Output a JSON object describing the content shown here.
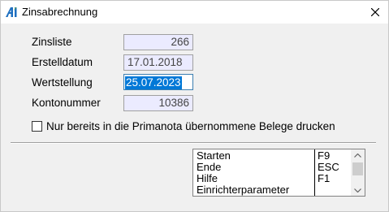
{
  "window": {
    "title": "Zinsabrechnung"
  },
  "form": {
    "zinsliste": {
      "label": "Zinsliste",
      "value": "266"
    },
    "erstelldatum": {
      "label": "Erstelldatum",
      "value": "17.01.2018"
    },
    "wertstellung": {
      "label": "Wertstellung",
      "value": "25.07.2023"
    },
    "kontonummer": {
      "label": "Kontonummer",
      "value": "10386"
    }
  },
  "checkbox": {
    "label": "Nur bereits in die Primanota übernommene Belege drucken",
    "checked": false
  },
  "menu": {
    "items": [
      {
        "label": "Starten",
        "key": "F9"
      },
      {
        "label": "Ende",
        "key": "ESC"
      },
      {
        "label": "Hilfe",
        "key": "F1"
      },
      {
        "label": "Einrichterparameter",
        "key": ""
      }
    ]
  },
  "icons": {
    "app": "app-logo-icon",
    "close": "close-icon"
  },
  "colors": {
    "selection": "#0078d7",
    "readonly_bg": "#ebebff"
  }
}
